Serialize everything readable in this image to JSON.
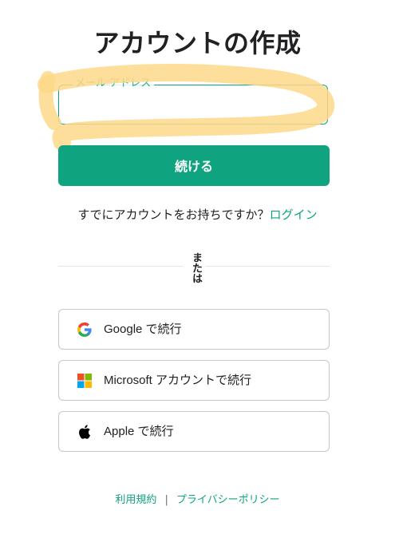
{
  "page": {
    "title": "アカウントの作成"
  },
  "email_field": {
    "label": "メール アドレス",
    "value": ""
  },
  "continue_button": {
    "label": "続ける"
  },
  "login_prompt": {
    "text": "すでにアカウントをお持ちですか？",
    "link_label": "ログイン"
  },
  "divider": {
    "text": "または"
  },
  "social_buttons": [
    {
      "icon": "google-icon",
      "label": "Google で続行"
    },
    {
      "icon": "microsoft-icon",
      "label": "Microsoft アカウントで続行"
    },
    {
      "icon": "apple-icon",
      "label": "Apple で続行"
    }
  ],
  "footer": {
    "terms_label": "利用規約",
    "separator": "|",
    "privacy_label": "プライバシーポリシー"
  },
  "colors": {
    "accent": "#10a37f",
    "highlight_marker": "#fdd88a",
    "text": "#202123",
    "border": "#c2c8d0"
  }
}
